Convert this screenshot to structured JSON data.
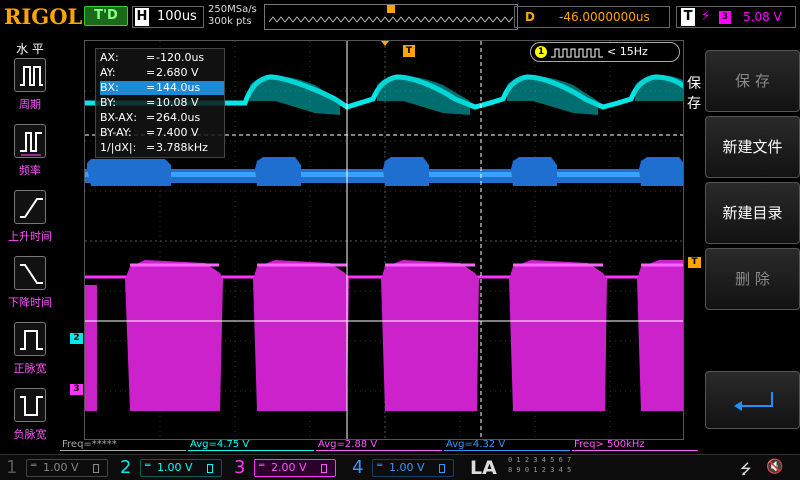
{
  "header": {
    "brand": "RIGOL",
    "trigger_status": "T'D",
    "horizontal": {
      "label": "H",
      "timebase": "100us"
    },
    "sample_rate": "250MSa/s",
    "memory_depth": "300k pts",
    "delay": {
      "label": "D",
      "value": "-46.0000000us"
    },
    "trigger": {
      "label": "T",
      "edge_glyph": "⚡",
      "source": "3",
      "level": "5.08 V"
    }
  },
  "left_toolbar": {
    "title": "水 平",
    "items": [
      {
        "label": "周期",
        "icon": "period-icon"
      },
      {
        "label": "频率",
        "icon": "frequency-icon"
      },
      {
        "label": "上升时间",
        "icon": "rise-time-icon"
      },
      {
        "label": "下降时间",
        "icon": "fall-time-icon"
      },
      {
        "label": "正脉宽",
        "icon": "positive-width-icon"
      },
      {
        "label": "负脉宽",
        "icon": "negative-width-icon"
      }
    ]
  },
  "cursor_measure": {
    "rows": [
      {
        "key": "AX:",
        "value": "-120.0us"
      },
      {
        "key": "AY:",
        "value": "2.680 V"
      },
      {
        "key": "BX:",
        "value": "144.0us"
      },
      {
        "key": "BY:",
        "value": "10.08 V"
      },
      {
        "key": "BX-AX:",
        "value": "264.0us"
      },
      {
        "key": "BY-AY:",
        "value": "7.400 V"
      },
      {
        "key": "1/|dX|:",
        "value": "3.788kHz"
      }
    ]
  },
  "freq_counter": {
    "channel": "1",
    "value": "< 15Hz"
  },
  "markers": {
    "ch2": "2",
    "ch3": "3",
    "trig_pos": "T",
    "trig_level": "T"
  },
  "right_menu": {
    "title": "保存",
    "buttons": [
      {
        "label": "保 存",
        "enabled": false
      },
      {
        "label": "新建文件",
        "enabled": true
      },
      {
        "label": "新建目录",
        "enabled": true
      },
      {
        "label": "删 除",
        "enabled": false
      }
    ],
    "return_icon": "return-arrow-icon"
  },
  "stats": [
    {
      "text": "Freq=*****",
      "color": "#aaaaaa"
    },
    {
      "text": "Avg=4.75 V",
      "color": "#00ffff"
    },
    {
      "text": "Avg=2.88 V",
      "color": "#ff55ff"
    },
    {
      "text": "Avg=4.32 V",
      "color": "#3399ff"
    },
    {
      "text": "Freq> 500kHz",
      "color": "#ff55ff"
    }
  ],
  "channels": [
    {
      "num": "1",
      "coupling": "═",
      "volts": "1.00 V",
      "color": "#555555",
      "active": false
    },
    {
      "num": "2",
      "coupling": "═",
      "volts": "1.00 V",
      "color": "#00ffff",
      "active": false
    },
    {
      "num": "3",
      "coupling": "═",
      "volts": "2.00 V",
      "color": "#ff33ff",
      "active": true
    },
    {
      "num": "4",
      "coupling": "═",
      "volts": "1.00 V",
      "color": "#3399ff",
      "active": false
    }
  ],
  "la": {
    "label": "LA",
    "digits": [
      "0 1 2 3  4 5 6 7",
      "8 9 0 1  2 3 4 5"
    ]
  },
  "status_icons": {
    "usb": "usb-icon",
    "speaker": "speaker-muted-icon"
  },
  "colors": {
    "ch1": "#ffff00",
    "ch2": "#00ffff",
    "ch3": "#ff33ff",
    "ch4": "#1e90ff",
    "accent": "#ffa500"
  }
}
